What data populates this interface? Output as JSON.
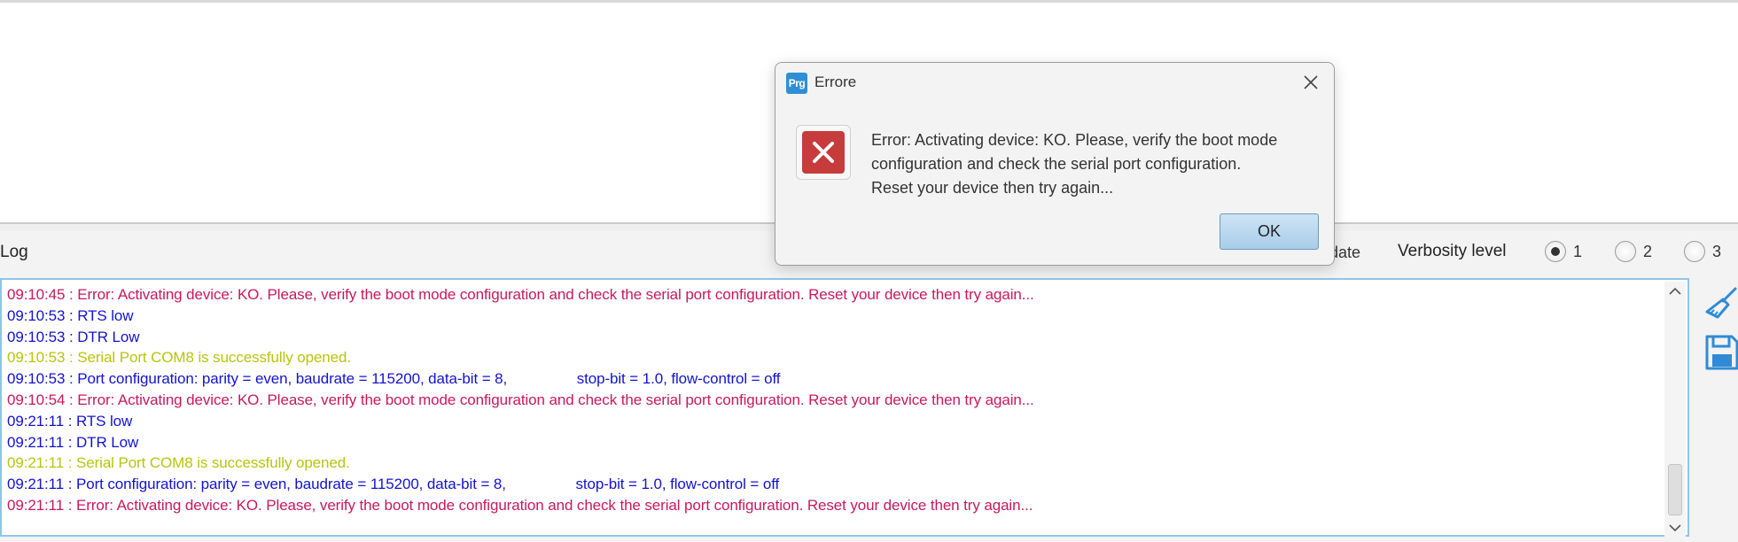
{
  "log_panel": {
    "title": "Log",
    "partial_option_label": "date",
    "verbosity": {
      "label": "Verbosity level",
      "options": [
        "1",
        "2",
        "3"
      ],
      "selected": "1"
    },
    "lines": [
      {
        "text": "09:10:45 : Error: Activating device: KO. Please, verify the boot mode configuration and check the serial port configuration. Reset your device then try again...",
        "type": "error"
      },
      {
        "text": "09:10:53 : RTS low",
        "type": "info"
      },
      {
        "text": "09:10:53 : DTR Low",
        "type": "info"
      },
      {
        "text": "09:10:53 : Serial Port COM8 is successfully opened.",
        "type": "success"
      },
      {
        "text": "09:10:53 : Port configuration: parity = even, baudrate = 115200, data-bit = 8,                 stop-bit = 1.0, flow-control = off",
        "type": "info"
      },
      {
        "text": "09:10:54 : Error: Activating device: KO. Please, verify the boot mode configuration and check the serial port configuration. Reset your device then try again...",
        "type": "error"
      },
      {
        "text": "09:21:11 : RTS low",
        "type": "info"
      },
      {
        "text": "09:21:11 : DTR Low",
        "type": "info"
      },
      {
        "text": "09:21:11 : Serial Port COM8 is successfully opened.",
        "type": "success"
      },
      {
        "text": "09:21:11 : Port configuration: parity = even, baudrate = 115200, data-bit = 8,                 stop-bit = 1.0, flow-control = off",
        "type": "info"
      },
      {
        "text": "09:21:11 : Error: Activating device: KO. Please, verify the boot mode configuration and check the serial port configuration. Reset your device then try again...",
        "type": "error"
      }
    ],
    "colors": {
      "error": "#c8195c",
      "info": "#1313d0",
      "success": "#b9c40c"
    },
    "side_icons": [
      "broom-icon",
      "save-icon"
    ]
  },
  "dialog": {
    "app_icon_text": "Prg",
    "title": "Errore",
    "message_lines": [
      "Error: Activating device: KO. Please, verify the boot mode",
      "configuration and check the serial port configuration.",
      "Reset your device then try again..."
    ],
    "ok_label": "OK",
    "icon": "error-x-icon",
    "icon_color": "#c63b3b"
  }
}
